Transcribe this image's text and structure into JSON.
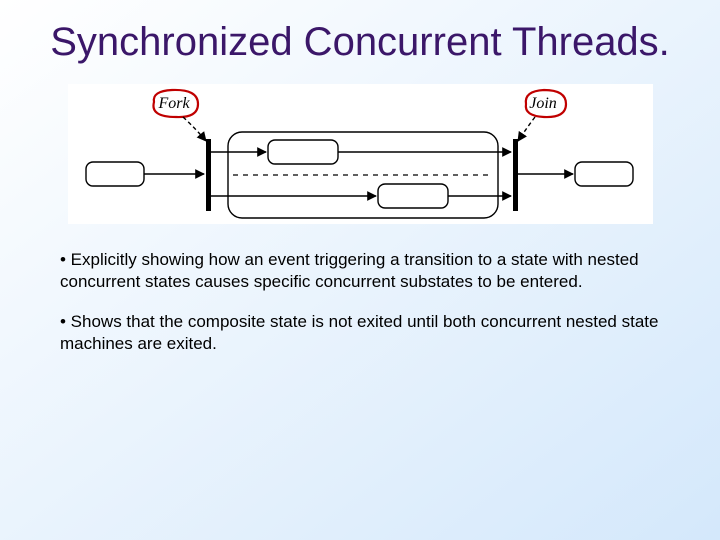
{
  "title": "Synchronized Concurrent Threads.",
  "diagram": {
    "fork_label": "Fork",
    "join_label": "Join"
  },
  "bullets": {
    "b1": "• Explicitly showing how an event triggering a transition to a state with nested concurrent states causes specific concurrent substates to be entered.",
    "b2": "• Shows that the composite state is not exited until both concurrent nested state machines are exited."
  }
}
